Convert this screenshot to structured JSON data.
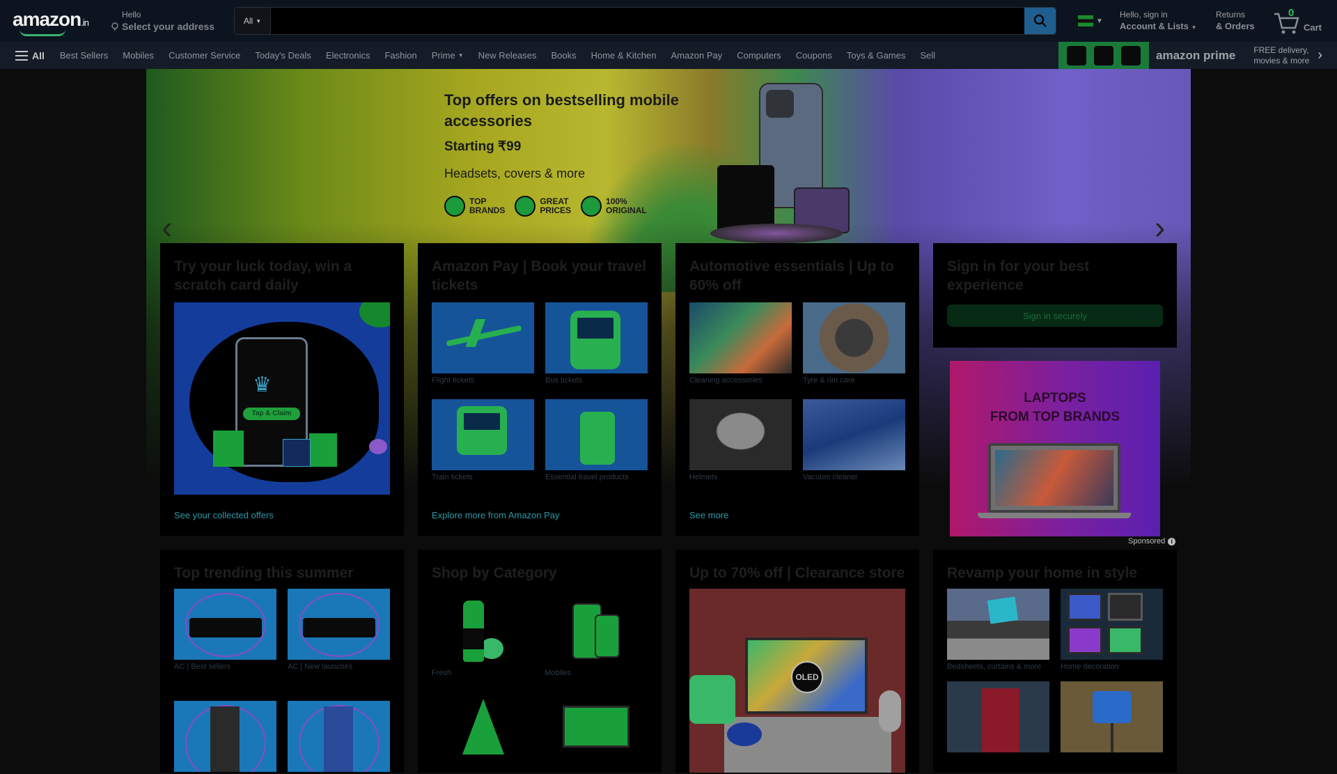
{
  "header": {
    "logo": "amazon",
    "logo_suffix": ".in",
    "location_line1": "Hello",
    "location_line2": "Select your address",
    "search_category": "All",
    "search_placeholder": "",
    "account_line1": "Hello, sign in",
    "account_line2": "Account & Lists",
    "orders_line1": "Returns",
    "orders_line2": "& Orders",
    "cart_count": "0",
    "cart_label": "Cart"
  },
  "nav": {
    "all_label": "All",
    "items": [
      "Best Sellers",
      "Mobiles",
      "Customer Service",
      "Today's Deals",
      "Electronics",
      "Fashion",
      "Prime",
      "New Releases",
      "Books",
      "Home & Kitchen",
      "Amazon Pay",
      "Computers",
      "Coupons",
      "Toys & Games",
      "Sell"
    ],
    "prime_wordmark": "amazon prime",
    "prime_promo_line1": "FREE delivery,",
    "prime_promo_line2": "movies & more"
  },
  "hero": {
    "title": "Top offers on bestselling mobile accessories",
    "price": "Starting ₹99",
    "subtitle": "Headsets, covers & more",
    "badges": [
      {
        "line1": "TOP",
        "line2": "BRANDS"
      },
      {
        "line1": "GREAT",
        "line2": "PRICES"
      },
      {
        "line1": "100%",
        "line2": "ORIGINAL"
      }
    ]
  },
  "cards": {
    "scratch": {
      "title": "Try your luck today, win a scratch card daily",
      "button": "Tap & Claim",
      "footer": "See your collected offers"
    },
    "amazonpay": {
      "title": "Amazon Pay | Book your travel tickets",
      "tiles": [
        "Flight tickets",
        "Bus tickets",
        "Train tickets",
        "Essential travel products"
      ],
      "footer": "Explore more from Amazon Pay"
    },
    "automotive": {
      "title": "Automotive essentials | Up to 60% off",
      "tiles": [
        "Cleaning accessories",
        "Tyre & rim care",
        "Helmets",
        "Vacuum cleaner"
      ],
      "footer": "See more"
    },
    "signin": {
      "title": "Sign in for your best experience",
      "button": "Sign in securely"
    },
    "ad": {
      "line1": "LAPTOPS",
      "line2": "FROM TOP BRANDS",
      "sponsored": "Sponsored"
    },
    "trending": {
      "title": "Top trending this summer",
      "tiles": [
        "AC | Best sellers",
        "AC | New launches",
        "",
        ""
      ]
    },
    "category": {
      "title": "Shop by Category",
      "tiles": [
        "Fresh",
        "Mobiles",
        "",
        ""
      ]
    },
    "clearance": {
      "title": "Up to 70% off | Clearance store",
      "oled_label": "OLED"
    },
    "home": {
      "title": "Revamp your home in style",
      "tiles": [
        "Bedsheets, curtains & more",
        "Home decoration",
        "",
        ""
      ]
    }
  }
}
